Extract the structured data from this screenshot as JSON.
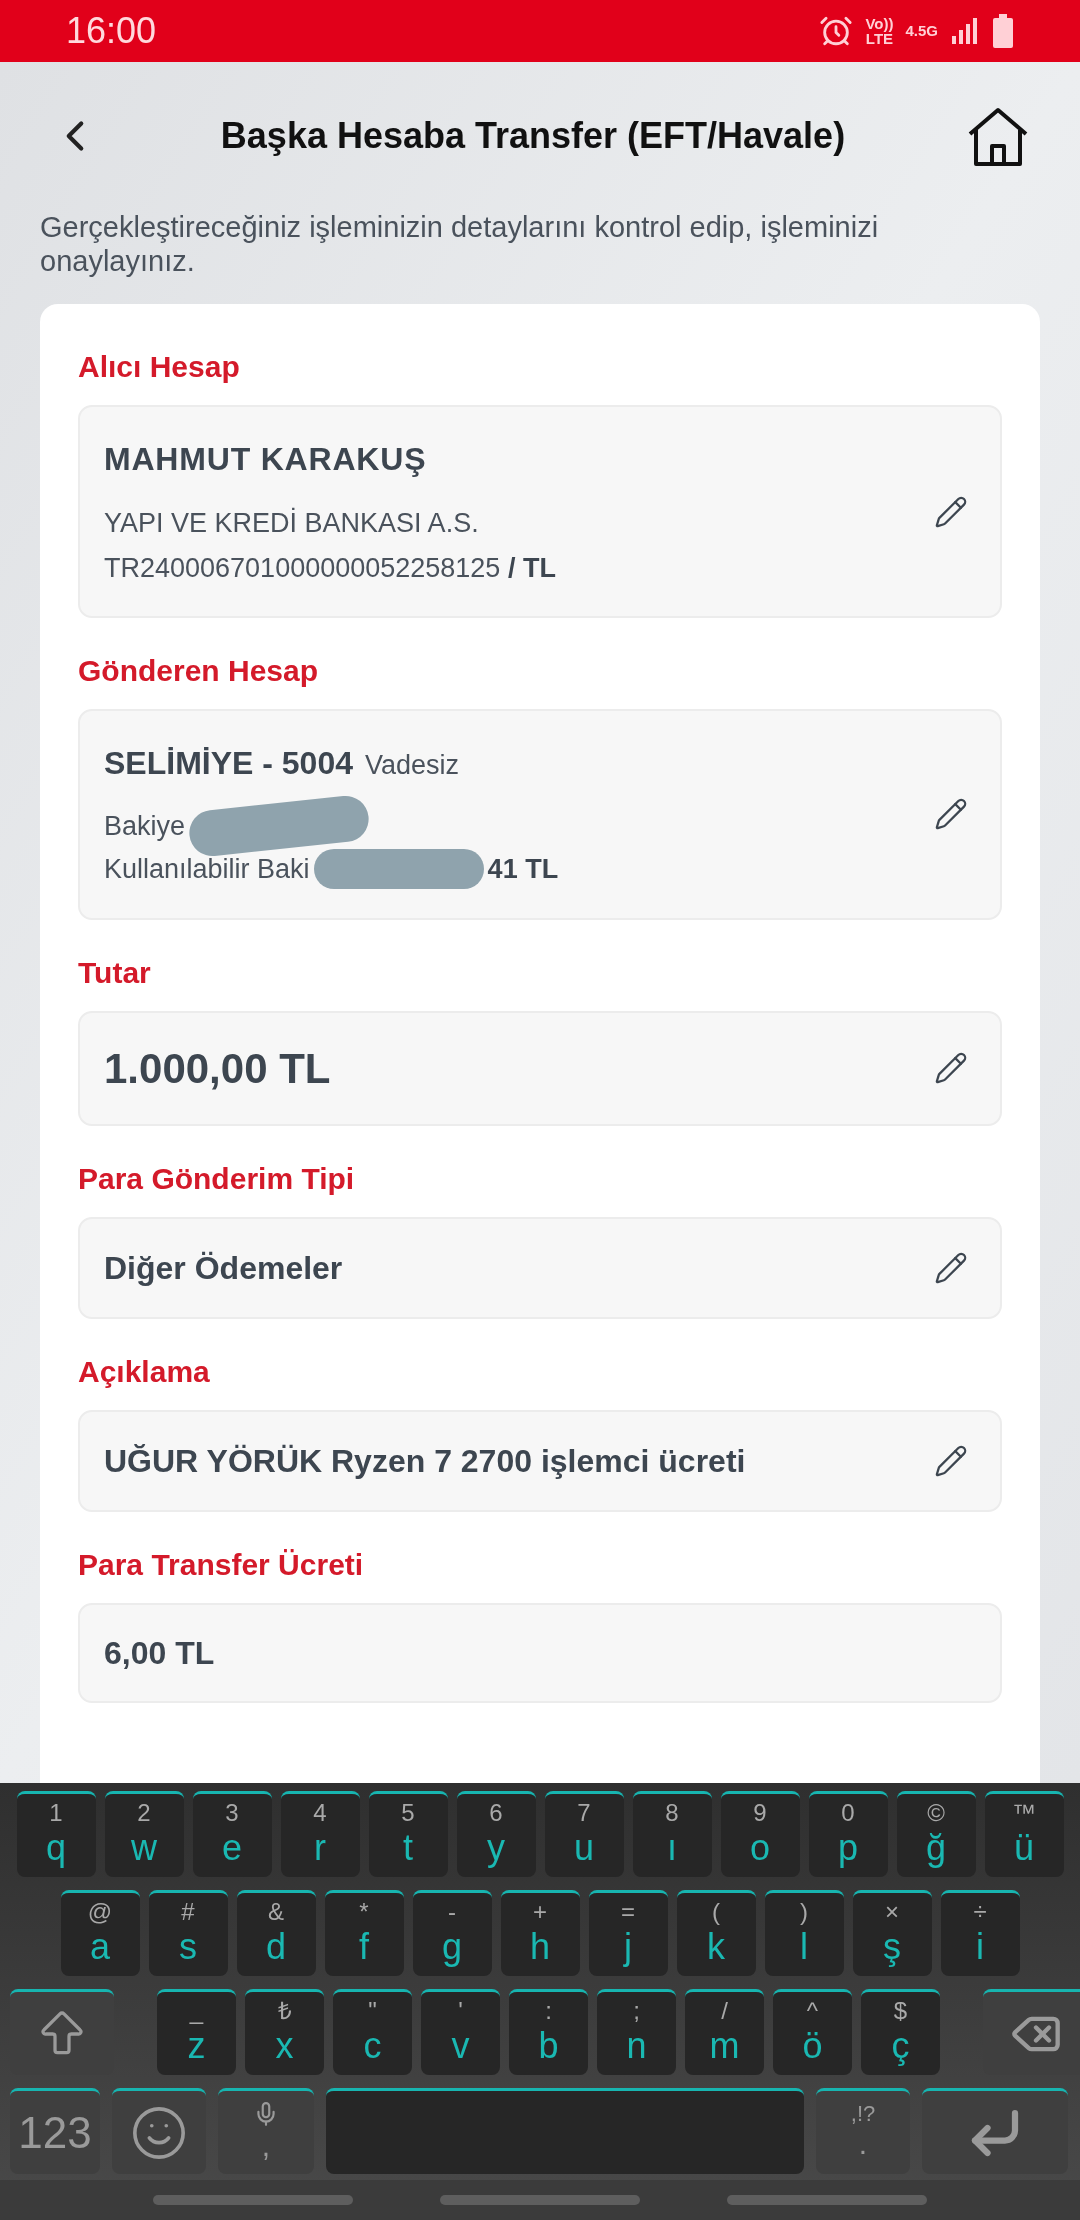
{
  "status_bar": {
    "time": "16:00",
    "volte": "Vo))",
    "lte": "LTE",
    "data": "4.5G"
  },
  "header": {
    "title": "Başka Hesaba Transfer (EFT/Havale)"
  },
  "description": "Gerçekleştireceğiniz işleminizin detaylarını kontrol edip, işleminizi onaylayınız.",
  "sections": [
    {
      "label": "Alıcı Hesap",
      "kind": "recipient",
      "name": "MAHMUT KARAKUŞ",
      "bank": "YAPI VE KREDİ BANKASI A.S.",
      "iban": "TR240006701000000052258125",
      "currency": "/ TL",
      "editable": true
    },
    {
      "label": "Gönderen Hesap",
      "kind": "sender",
      "name": "SELİMİYE - 5004",
      "type": "Vadesiz",
      "balance_label": "Bakiye",
      "available_label": "Kullanılabilir Baki",
      "available_tail": "41 TL",
      "editable": true
    },
    {
      "label": "Tutar",
      "kind": "amount",
      "value": "1.000,00 TL",
      "editable": true
    },
    {
      "label": "Para Gönderim Tipi",
      "kind": "text",
      "value": "Diğer Ödemeler",
      "editable": true
    },
    {
      "label": "Açıklama",
      "kind": "text",
      "value": "UĞUR YÖRÜK Ryzen 7 2700 işlemci ücreti",
      "editable": true
    },
    {
      "label": "Para Transfer Ücreti",
      "kind": "text",
      "value": "6,00 TL",
      "editable": false
    }
  ],
  "keyboard": {
    "rows": [
      [
        {
          "kind": "char",
          "hint": "1",
          "label": "q"
        },
        {
          "kind": "char",
          "hint": "2",
          "label": "w"
        },
        {
          "kind": "char",
          "hint": "3",
          "label": "e"
        },
        {
          "kind": "char",
          "hint": "4",
          "label": "r"
        },
        {
          "kind": "char",
          "hint": "5",
          "label": "t"
        },
        {
          "kind": "char",
          "hint": "6",
          "label": "y"
        },
        {
          "kind": "char",
          "hint": "7",
          "label": "u"
        },
        {
          "kind": "char",
          "hint": "8",
          "label": "ı"
        },
        {
          "kind": "char",
          "hint": "9",
          "label": "o"
        },
        {
          "kind": "char",
          "hint": "0",
          "label": "p"
        },
        {
          "kind": "char",
          "hint": "©",
          "label": "ğ"
        },
        {
          "kind": "char",
          "hint": "™",
          "label": "ü"
        }
      ],
      [
        {
          "kind": "char",
          "hint": "@",
          "label": "a"
        },
        {
          "kind": "char",
          "hint": "#",
          "label": "s"
        },
        {
          "kind": "char",
          "hint": "&",
          "label": "d"
        },
        {
          "kind": "char",
          "hint": "*",
          "label": "f"
        },
        {
          "kind": "char",
          "hint": "-",
          "label": "g"
        },
        {
          "kind": "char",
          "hint": "+",
          "label": "h"
        },
        {
          "kind": "char",
          "hint": "=",
          "label": "j"
        },
        {
          "kind": "char",
          "hint": "(",
          "label": "k"
        },
        {
          "kind": "char",
          "hint": ")",
          "label": "l"
        },
        {
          "kind": "char",
          "hint": "×",
          "label": "ş"
        },
        {
          "kind": "char",
          "hint": "÷",
          "label": "i"
        }
      ],
      [
        {
          "kind": "shift"
        },
        {
          "kind": "char",
          "hint": "_",
          "label": "z"
        },
        {
          "kind": "char",
          "hint": "₺",
          "label": "x"
        },
        {
          "kind": "char",
          "hint": "\"",
          "label": "c"
        },
        {
          "kind": "char",
          "hint": "'",
          "label": "v"
        },
        {
          "kind": "char",
          "hint": ":",
          "label": "b"
        },
        {
          "kind": "char",
          "hint": ";",
          "label": "n"
        },
        {
          "kind": "char",
          "hint": "/",
          "label": "m"
        },
        {
          "kind": "char",
          "hint": "^",
          "label": "ö"
        },
        {
          "kind": "char",
          "hint": "$",
          "label": "ç"
        },
        {
          "kind": "backspace"
        }
      ],
      [
        {
          "kind": "numbers",
          "label": "123"
        },
        {
          "kind": "emoji"
        },
        {
          "kind": "mic",
          "label": ","
        },
        {
          "kind": "space"
        },
        {
          "kind": "punct",
          "hint": ",!?",
          "label": "."
        },
        {
          "kind": "enter"
        }
      ]
    ]
  }
}
